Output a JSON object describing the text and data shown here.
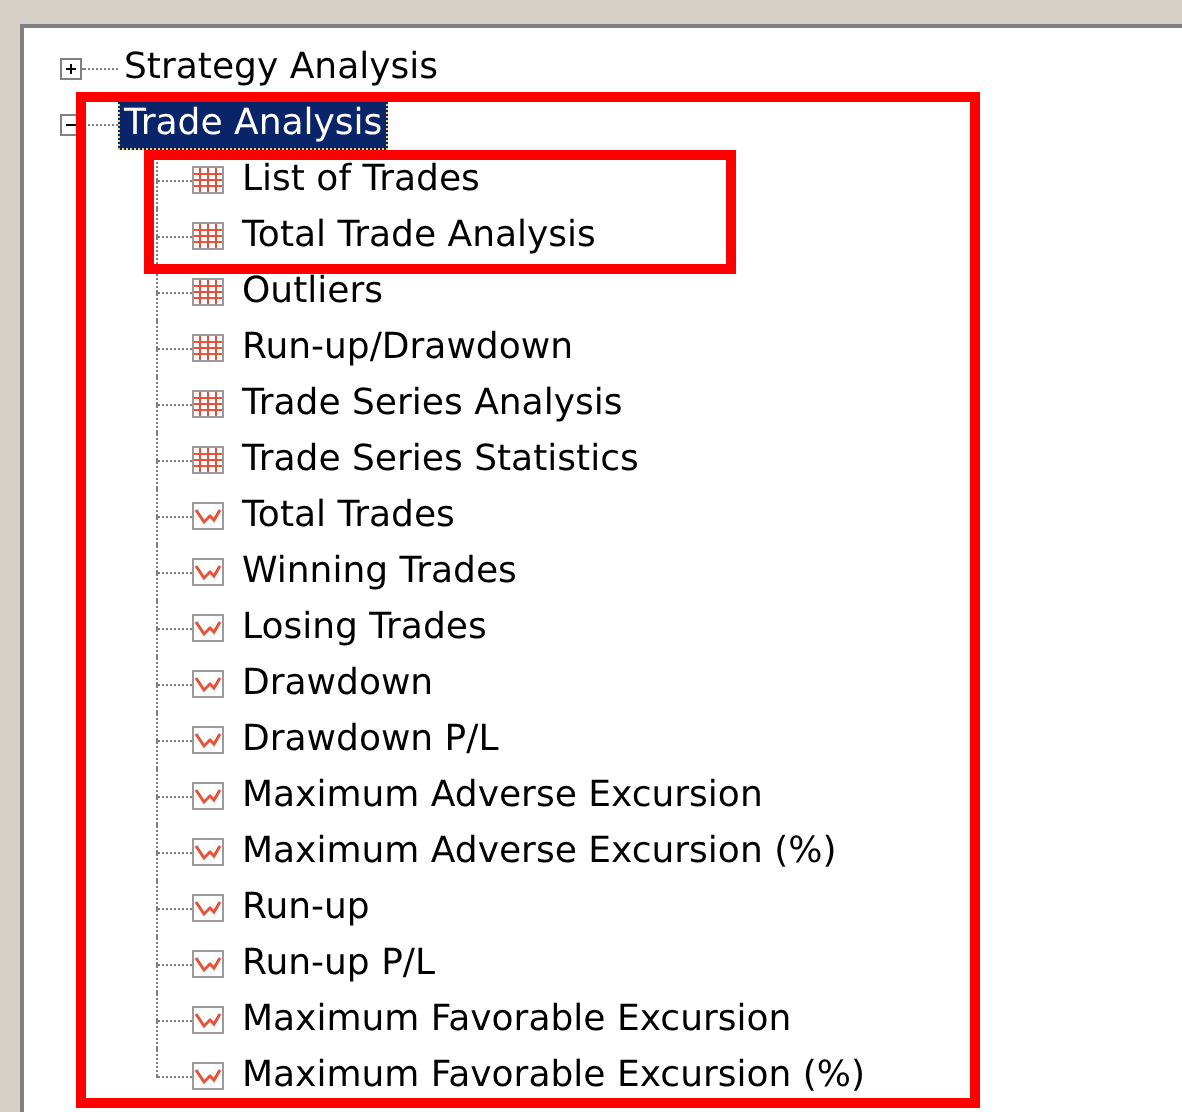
{
  "tree": [
    {
      "label": "Strategy Analysis",
      "expanded": false,
      "selected": false
    },
    {
      "label": "Trade Analysis",
      "expanded": true,
      "selected": true,
      "children": [
        {
          "label": "List of Trades",
          "kind": "table"
        },
        {
          "label": "Total Trade Analysis",
          "kind": "table"
        },
        {
          "label": "Outliers",
          "kind": "table"
        },
        {
          "label": "Run-up/Drawdown",
          "kind": "table"
        },
        {
          "label": "Trade Series Analysis",
          "kind": "table"
        },
        {
          "label": "Trade Series Statistics",
          "kind": "table"
        },
        {
          "label": "Total Trades",
          "kind": "chart"
        },
        {
          "label": "Winning Trades",
          "kind": "chart"
        },
        {
          "label": "Losing Trades",
          "kind": "chart"
        },
        {
          "label": "Drawdown",
          "kind": "chart"
        },
        {
          "label": "Drawdown P/L",
          "kind": "chart"
        },
        {
          "label": "Maximum Adverse Excursion",
          "kind": "chart"
        },
        {
          "label": "Maximum Adverse Excursion (%)",
          "kind": "chart"
        },
        {
          "label": "Run-up",
          "kind": "chart"
        },
        {
          "label": "Run-up P/L",
          "kind": "chart"
        },
        {
          "label": "Maximum Favorable Excursion",
          "kind": "chart"
        },
        {
          "label": "Maximum Favorable Excursion (%)",
          "kind": "chart"
        }
      ]
    }
  ]
}
